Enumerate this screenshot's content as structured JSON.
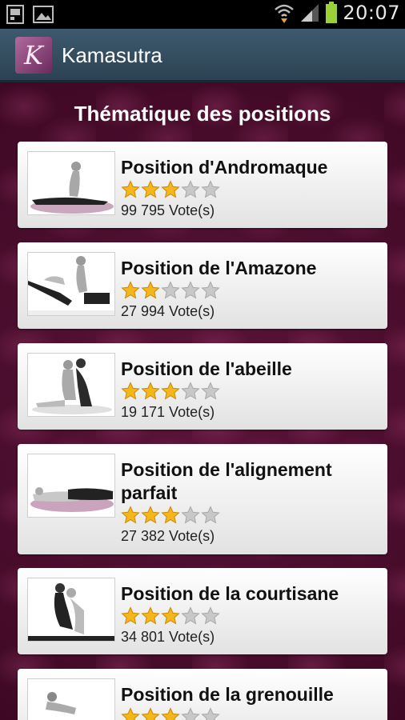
{
  "status": {
    "time": "20:07"
  },
  "app": {
    "title": "Kamasutra",
    "logo_letter": "K"
  },
  "section": {
    "title": "Thématique des positions"
  },
  "items": [
    {
      "title": "Position d'Andromaque",
      "rating": 3,
      "max": 5,
      "votes": "99 795 Vote(s)"
    },
    {
      "title": "Position de l'Amazone",
      "rating": 2,
      "max": 5,
      "votes": "27 994 Vote(s)"
    },
    {
      "title": "Position de l'abeille",
      "rating": 3,
      "max": 5,
      "votes": "19 171 Vote(s)"
    },
    {
      "title": "Position de l'alignement parfait",
      "rating": 3,
      "max": 5,
      "votes": "27 382 Vote(s)"
    },
    {
      "title": "Position de la courtisane",
      "rating": 3,
      "max": 5,
      "votes": "34 801 Vote(s)"
    },
    {
      "title": "Position de la grenouille",
      "rating": 3,
      "max": 5,
      "votes": ""
    }
  ],
  "colors": {
    "star_on": "#f5b51c",
    "star_off": "#c8c8c8",
    "background": "#4d0c2f",
    "actionbar": "#34505f"
  }
}
